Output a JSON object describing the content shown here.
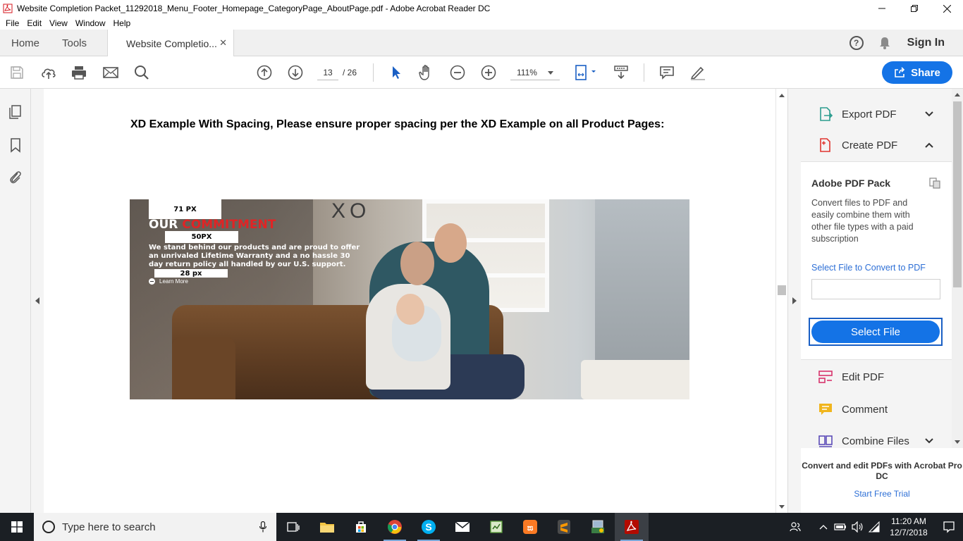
{
  "window": {
    "title": "Website Completion Packet_11292018_Menu_Footer_Homepage_CategoryPage_AboutPage.pdf - Adobe Acrobat Reader DC"
  },
  "menubar": [
    "File",
    "Edit",
    "View",
    "Window",
    "Help"
  ],
  "tabs": {
    "home": "Home",
    "tools": "Tools",
    "document": "Website Completio...",
    "sign_in": "Sign In"
  },
  "toolbar": {
    "page_current": "13",
    "page_total": "/ 26",
    "zoom": "111%",
    "share_label": "Share",
    "accent_color": "#1473e6"
  },
  "document": {
    "heading": "XD Example With Spacing, Please ensure proper spacing per the XD Example on all Product Pages:",
    "hero": {
      "label_top": "71 PX",
      "label_mid": "50PX",
      "label_bottom": "28 px",
      "headline_white": "OUR ",
      "headline_red": "COMMITMENT",
      "body": "We stand behind our products and are proud to offer an unrivaled Lifetime Warranty and a no hassle 30 day return policy all handled by our U.S. support.",
      "learn_more": "Learn More",
      "wall_text": "XO"
    }
  },
  "right_pane": {
    "tools": [
      {
        "label": "Export PDF",
        "icon": "export-pdf-icon",
        "chevron": "down"
      },
      {
        "label": "Create PDF",
        "icon": "create-pdf-icon",
        "chevron": "up"
      },
      {
        "label": "Edit PDF",
        "icon": "edit-pdf-icon"
      },
      {
        "label": "Comment",
        "icon": "comment-icon"
      },
      {
        "label": "Combine Files",
        "icon": "combine-files-icon",
        "chevron": "down"
      }
    ],
    "pack": {
      "title": "Adobe PDF Pack",
      "description": "Convert files to PDF and easily combine them with other file types with a paid subscription",
      "link": "Select File to Convert to PDF",
      "button": "Select File"
    },
    "promo": {
      "text": "Convert and edit PDFs with Acrobat Pro DC",
      "link": "Start Free Trial"
    }
  },
  "taskbar": {
    "search_placeholder": "Type here to search",
    "time": "11:20 AM",
    "date": "12/7/2018"
  }
}
